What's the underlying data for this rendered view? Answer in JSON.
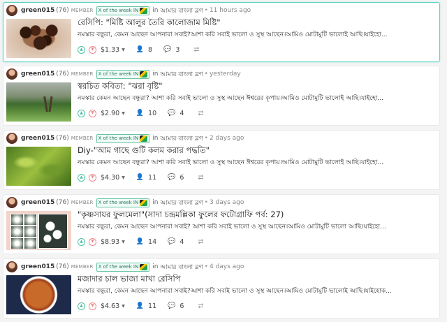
{
  "posts": [
    {
      "author": "green015",
      "reputation": "(76)",
      "role": "MEMBER",
      "badge": "X of the week IN",
      "in_label": "in",
      "community": "আমার বাংলা ব্লগ",
      "time": "11 hours ago",
      "title": "রেসিপি: \"মিষ্টি আলুর তৈরি কালোজাম মিষ্টি\"",
      "summary": "নমস্কার বন্ধুরা, কেমন আছেন আপনারা সবাই?আশা করি সবাই ভালো ও সুস্থ আছেন।আমিও মোটামুটি ভালোই আছি।যাইহো...",
      "payout": "$1.33",
      "votes": "8",
      "comments": "3"
    },
    {
      "author": "green015",
      "reputation": "(76)",
      "role": "MEMBER",
      "badge": "X of the week IN",
      "in_label": "in",
      "community": "আমার বাংলা ব্লগ",
      "time": "yesterday",
      "title": "স্বরচিত কবিতা: \"ঝরা বৃষ্টি\"",
      "summary": "নমস্কার কেমন আছেন বন্ধুরা? আশা করি সবাই ভালো ও সুস্থ আছেন ঈশ্বরের কৃপায়।আমিও মোটামুটি ভালোই আছি।যাইহো...",
      "payout": "$2.90",
      "votes": "10",
      "comments": "4"
    },
    {
      "author": "green015",
      "reputation": "(76)",
      "role": "MEMBER",
      "badge": "X of the week IN",
      "in_label": "in",
      "community": "আমার বাংলা ব্লগ",
      "time": "2 days ago",
      "title": "Diy-\"আম গাছে গুটি কলম করার পদ্ধতি\"",
      "summary": "নমস্কার কেমন আছেন বন্ধুরা? আশা করি সবাই ভালো ও সুস্থ আছেন ঈশ্বরের কৃপায়।আমিও মোটামুটি ভালোই আছি।যাইহো...",
      "payout": "$4.30",
      "votes": "11",
      "comments": "6"
    },
    {
      "author": "green015",
      "reputation": "(76)",
      "role": "MEMBER",
      "badge": "X of the week IN",
      "in_label": "in",
      "community": "আমার বাংলা ব্লগ",
      "time": "3 days ago",
      "title": "\"কৃষ্ণসায়র ফুলমেলা\"(সাদা চন্দ্রমল্লিকা ফুলের ফটোগ্রাফি পর্ব: 27)",
      "summary": "নমস্কার বন্ধুরা, কেমন আছেন আপনারা সবাই? আশা করি সবাই ভালো ও সুস্থ আছেন।আমিও মোটামুটি ভালো আছি।যাইহো...",
      "payout": "$8.93",
      "votes": "14",
      "comments": "4"
    },
    {
      "author": "green015",
      "reputation": "(76)",
      "role": "MEMBER",
      "badge": "X of the week IN",
      "in_label": "in",
      "community": "আমার বাংলা ব্লগ",
      "time": "4 days ago",
      "title": "মজাদার চাল ভাজা মাখা রেসিপি",
      "summary": "নমস্কার বন্ধুরা, কেমন আছেন আপনারা সবাই?আশা করি সবাই ভালো ও সুস্থ আছেন।আমিও মোটামুটি ভালোই আছি।যাইহোক...",
      "payout": "$4.63",
      "votes": "11",
      "comments": "6"
    }
  ],
  "icons": {
    "upvote": "chevron-up-icon",
    "downvote": "chevron-down-icon",
    "votes": "person-icon",
    "comments": "comment-icon",
    "reblog": "reblog-icon"
  },
  "colors": {
    "upvote": "#4fc3a1",
    "downvote": "#f08a8a",
    "active_border": "#5fd3c3"
  }
}
